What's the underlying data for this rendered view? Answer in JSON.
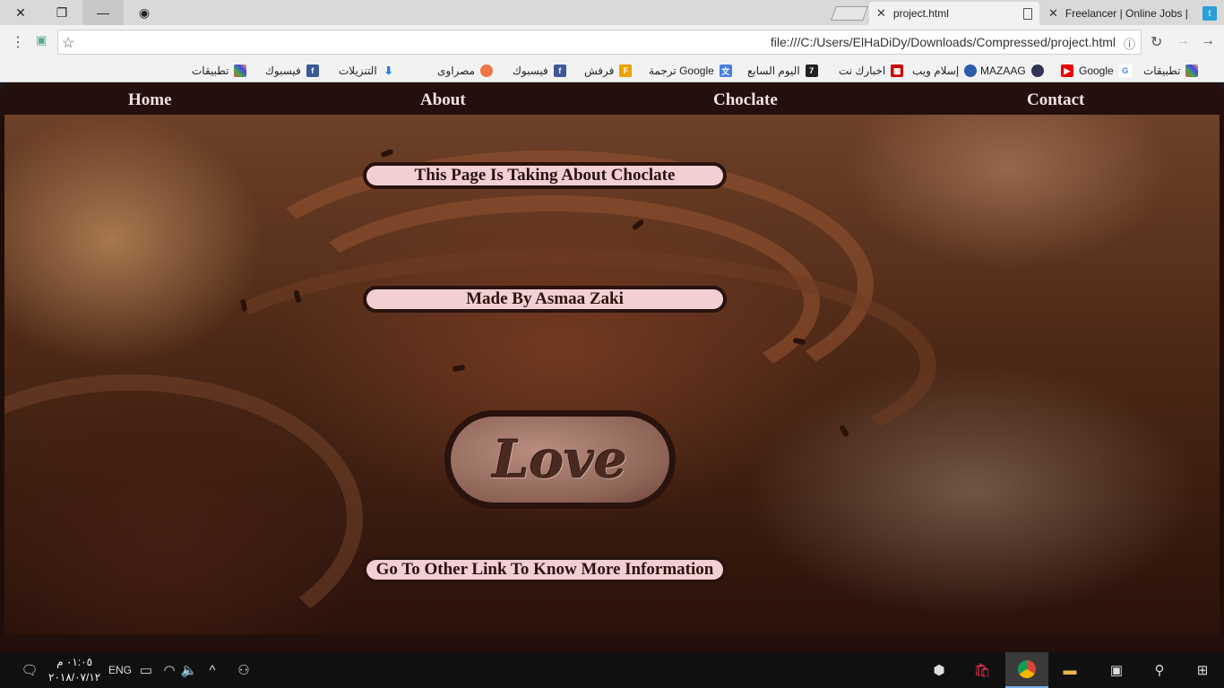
{
  "browser": {
    "tabs": [
      {
        "label": "project.html",
        "active": true
      },
      {
        "label": "Freelancer | Online Jobs |",
        "active": false
      }
    ],
    "url": "file:///C:/Users/ElHaDiDy/Downloads/Compressed/project.html",
    "bookmarks": [
      {
        "label": "تطبيقات",
        "icon": "apps-grid-icon"
      },
      {
        "label": "Google",
        "icon": "google-icon"
      },
      {
        "label": "",
        "icon": "youtube-icon"
      },
      {
        "label": "MAZAAG",
        "icon": "mazaag-icon"
      },
      {
        "label": "إسلام ويب",
        "icon": "islamweb-icon"
      },
      {
        "label": "اخبارك نت",
        "icon": "akhbarak-icon"
      },
      {
        "label": "اليوم السابع",
        "icon": "youm7-icon"
      },
      {
        "label": "ترجمة Google",
        "icon": "google-translate-icon"
      },
      {
        "label": "فرفش",
        "icon": "farfesh-icon"
      },
      {
        "label": "فيسبوك",
        "icon": "facebook-icon"
      },
      {
        "label": "مصراوى",
        "icon": "masrawy-icon"
      },
      {
        "label": "التنزيلات",
        "icon": "download-icon"
      },
      {
        "label": "فيسبوك",
        "icon": "facebook-icon"
      },
      {
        "label": "تطبيقات",
        "icon": "apps-grid-icon"
      }
    ]
  },
  "site": {
    "nav": [
      "Home",
      "About",
      "Choclate",
      "Contact"
    ],
    "heading": "This Page Is Taking About Choclate",
    "author": "Made By Asmaa Zaki",
    "love_image_text": "Love",
    "link_text": "Go To Other Link To Know More Information"
  },
  "taskbar": {
    "language": "ENG",
    "time": "٠١:٠٥ م",
    "date": "٢٠١٨/٠٧/١٢"
  },
  "colors": {
    "page_bg": "#1f0d0a",
    "pill_bg": "#f1cfd2",
    "nav_text": "#f0e4de"
  }
}
